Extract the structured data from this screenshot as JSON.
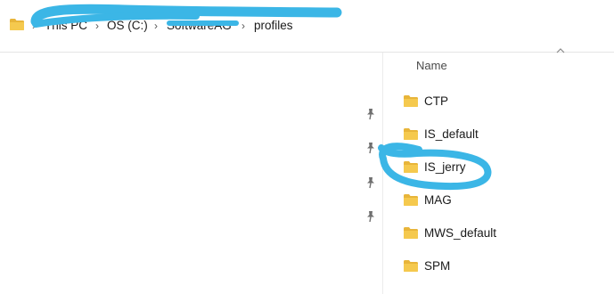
{
  "breadcrumb": {
    "items": [
      "This PC",
      "OS (C:)",
      "SoftwareAG",
      "profiles"
    ],
    "separator_glyph": "›"
  },
  "file_list": {
    "column_name": "Name",
    "items": [
      {
        "name": "CTP",
        "icon": "folder-icon"
      },
      {
        "name": "IS_default",
        "icon": "folder-icon"
      },
      {
        "name": "IS_jerry",
        "icon": "folder-icon"
      },
      {
        "name": "MAG",
        "icon": "folder-icon"
      },
      {
        "name": "MWS_default",
        "icon": "folder-icon"
      },
      {
        "name": "SPM",
        "icon": "folder-icon"
      }
    ]
  },
  "quick_access": {
    "pin_icons": [
      "pin-icon",
      "pin-icon",
      "pin-icon",
      "pin-icon"
    ]
  },
  "colors": {
    "folder": "#f5c94e",
    "folder_back": "#e8b53a",
    "highlighter": "#3bb6e6",
    "header_text": "#4a4a4a"
  }
}
